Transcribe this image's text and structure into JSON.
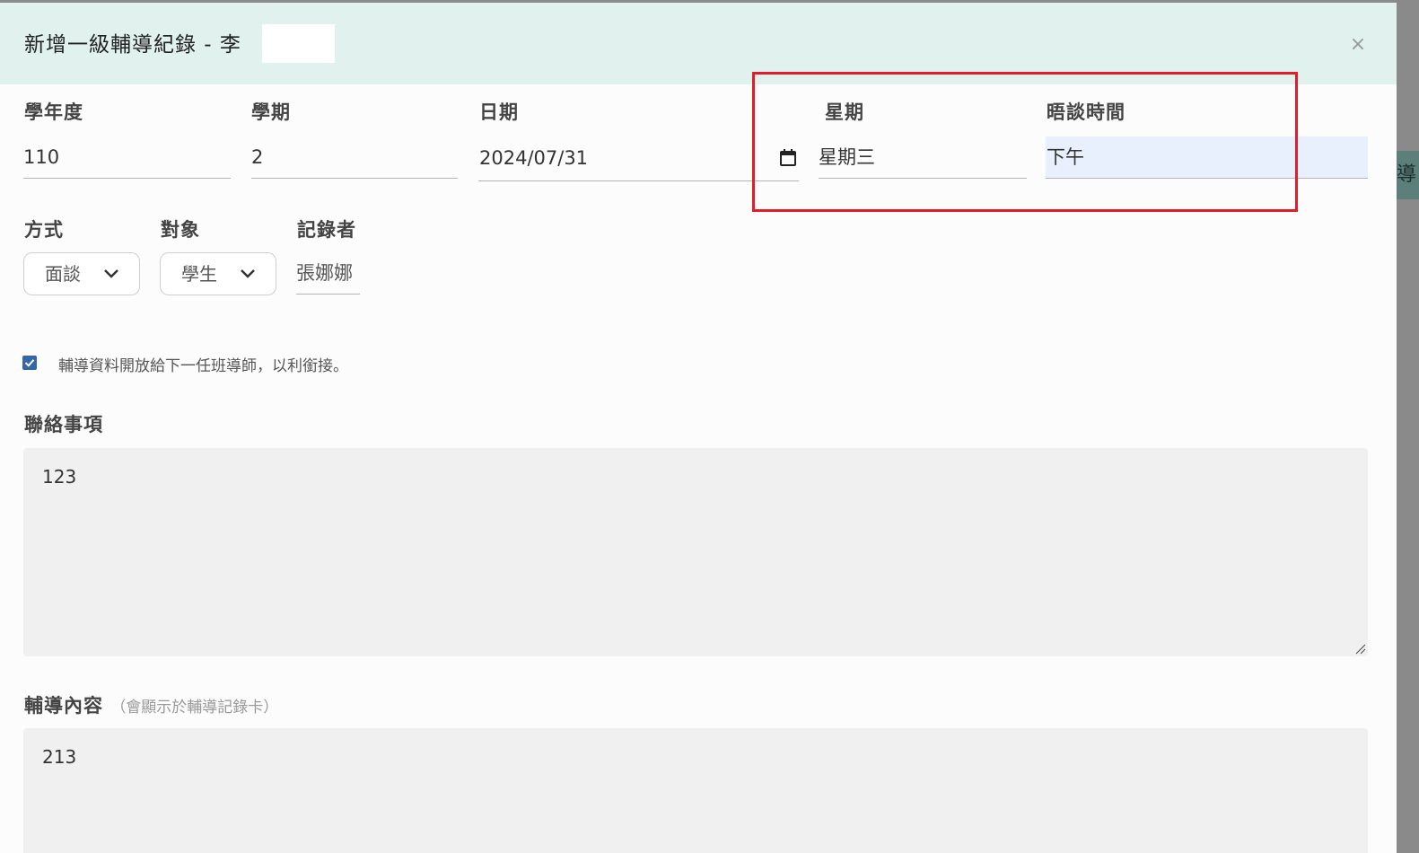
{
  "dialog": {
    "title": "新增一級輔導紀錄 - 李",
    "close_icon": "×"
  },
  "fields": {
    "school_year": {
      "label": "學年度",
      "value": "110"
    },
    "semester": {
      "label": "學期",
      "value": "2"
    },
    "date": {
      "label": "日期",
      "value": "2024/07/31",
      "icon": "calendar-icon"
    },
    "weekday": {
      "label": "星期",
      "value": "星期三"
    },
    "talk_time": {
      "label": "晤談時間",
      "value": "下午"
    },
    "method": {
      "label": "方式",
      "selected": "面談"
    },
    "target": {
      "label": "對象",
      "selected": "學生"
    },
    "recorder": {
      "label": "記錄者",
      "value": "張娜娜"
    }
  },
  "share_checkbox": {
    "checked": true,
    "label": "輔導資料開放給下一任班導師，以利銜接。"
  },
  "contact_notes": {
    "label": "聯絡事項",
    "value": "123"
  },
  "counsel_content": {
    "label": "輔導內容",
    "hint": "（會顯示於輔導記錄卡）",
    "value": "213"
  },
  "background": {
    "edge_text": "導"
  },
  "colors": {
    "header_bg": "#e1f1ee",
    "highlight_border": "#e11d2a",
    "checkbox": "#3367a8",
    "focused_field_bg": "#e8f0fe"
  }
}
